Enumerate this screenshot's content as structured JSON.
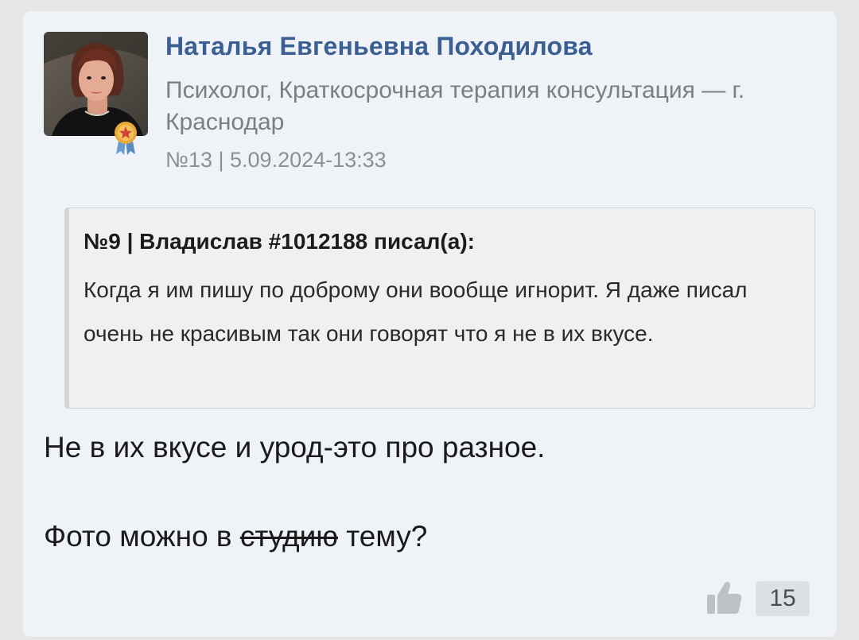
{
  "post": {
    "author_name": "Наталья Евгеньевна Походилова",
    "author_info": "Психолог, Краткосрочная терапия консультация — г. Краснодар",
    "meta": "№13 | 5.09.2024-13:33",
    "avatar_icon": "user-photo",
    "badge_icon": "award-ribbon-icon",
    "quote": {
      "header": "№9 | Владислав #1012188 писал(а):",
      "text": "Когда я им пишу по доброму они вообще игнорит. Я даже писал очень не красивым так они говорят что я не в их вкусе."
    },
    "body": {
      "line1": "Не в их вкусе и урод-это про разное.",
      "line2_before": "Фото можно в ",
      "line2_struck": "студию",
      "line2_after": " тему?"
    },
    "likes": {
      "icon": "thumbs-up-icon",
      "count": "15"
    }
  },
  "colors": {
    "card_bg": "#eff3f7",
    "author_name": "#3c5f93",
    "muted_text": "#7a7f85",
    "quote_bg": "#f0f0f0",
    "badge_gold": "#e9a93a",
    "badge_ribbon": "#6a9bd0"
  }
}
